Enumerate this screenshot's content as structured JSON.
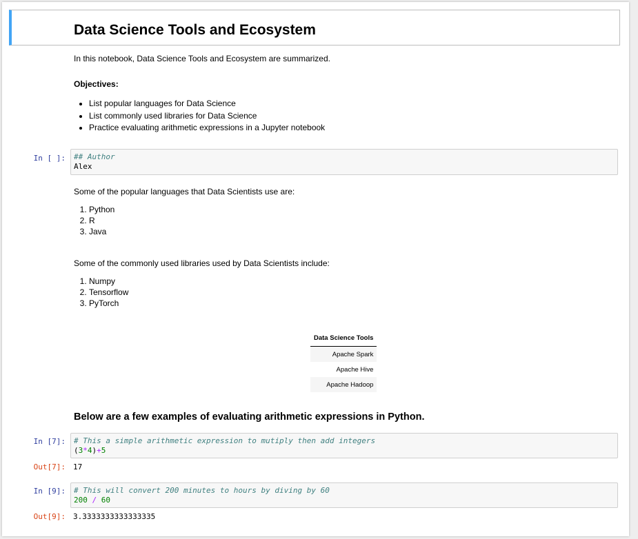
{
  "notebook": {
    "title": "Data Science Tools and Ecosystem",
    "intro": "In this notebook, Data Science Tools and Ecosystem are summarized.",
    "objectives_heading": "Objectives:",
    "objectives": [
      "List popular languages for Data Science",
      "List commonly used libraries for Data Science",
      "Practice evaluating arithmetic expressions in a Jupyter notebook"
    ],
    "author_cell": {
      "prompt": "In [ ]:",
      "line1": "## Author",
      "line2": "Alex"
    },
    "languages_intro": "Some of the popular languages that Data Scientists use are:",
    "languages": [
      "Python",
      "R",
      "Java"
    ],
    "libraries_intro": "Some of the commonly used libraries used by Data Scientists include:",
    "libraries": [
      "Numpy",
      "Tensorflow",
      "PyTorch"
    ],
    "tools_table": {
      "header": "Data Science Tools",
      "rows": [
        "Apache Spark",
        "Apache Hive",
        "Apache Hadoop"
      ]
    },
    "examples_heading": "Below are a few examples of evaluating arithmetic expressions in Python.",
    "cell7": {
      "prompt": "In [7]:",
      "comment": "#  This a simple arithmetic expression to mutiply then add integers",
      "code": {
        "p1": "(",
        "n1": "3",
        "op1": "*",
        "n2": "4",
        "p2": ")",
        "op2": "+",
        "n3": "5"
      },
      "out_prompt": "Out[7]:",
      "output": "17"
    },
    "cell9": {
      "prompt": "In [9]:",
      "comment": "# This will convert 200 minutes to hours by diving by 60",
      "code": {
        "n1": "200",
        "op": " / ",
        "n2": "60"
      },
      "out_prompt": "Out[9]:",
      "output": "3.3333333333333335"
    }
  },
  "colors": {
    "selected_bar": "#42a5f5",
    "in_prompt": "#303f9f",
    "out_prompt": "#d84315",
    "comment": "#408080",
    "number": "#008000",
    "operator": "#aa22ff"
  }
}
